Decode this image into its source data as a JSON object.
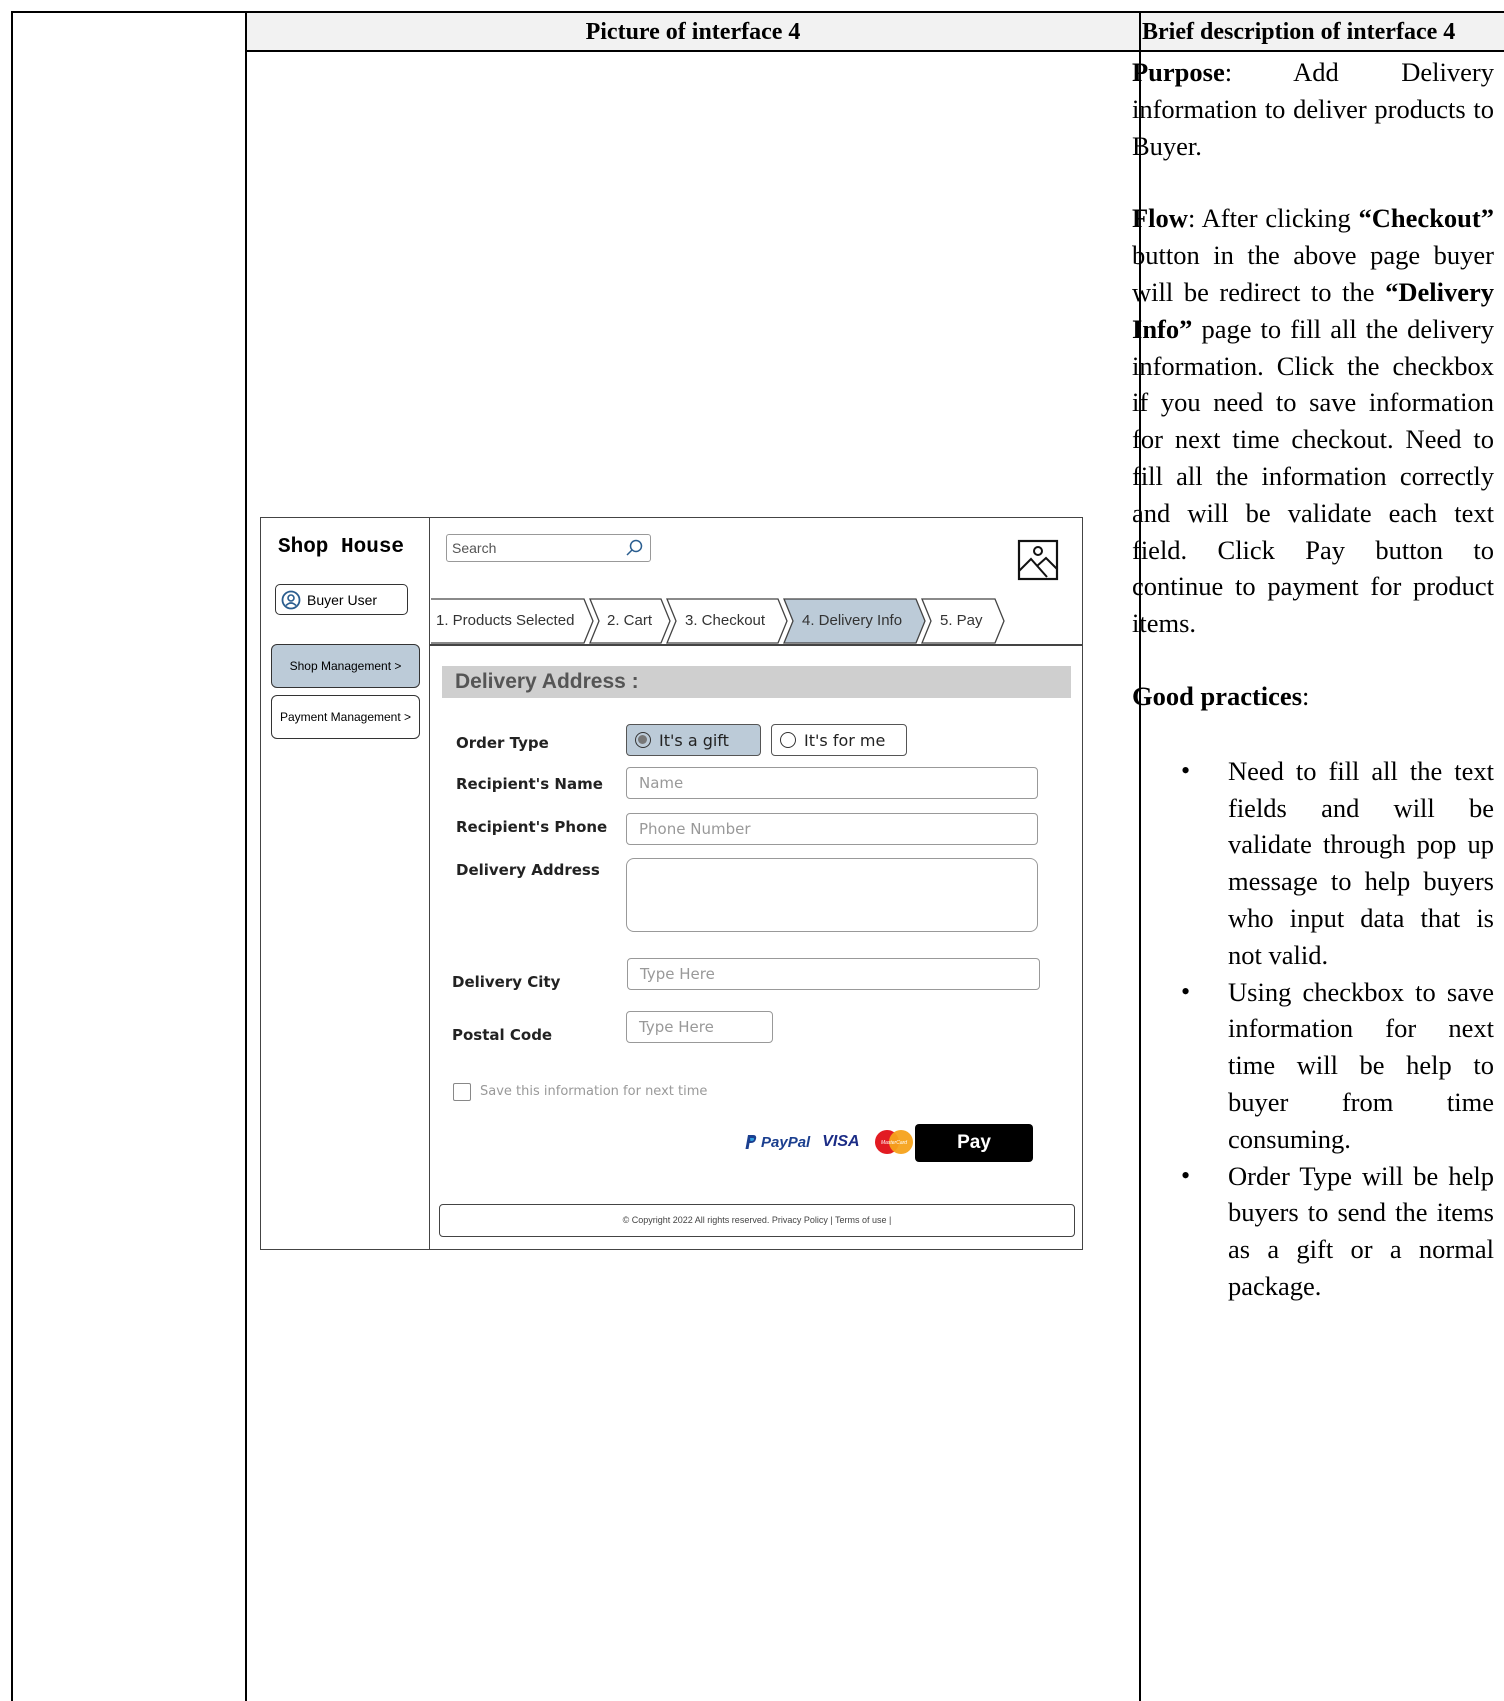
{
  "table": {
    "header_left": "Picture of interface 4",
    "header_right": "Brief description of interface 4"
  },
  "description": {
    "purpose_label": "Purpose",
    "purpose_text": ":   Add   Delivery information to deliver products to Buyer.",
    "flow_label": "Flow",
    "flow_text_1": ":   After   clicking ",
    "flow_bold_1": "“Checkout”",
    "flow_text_2": " button in the above page buyer will be redirect to the ",
    "flow_bold_2": "“Delivery Info”",
    "flow_text_3": " page to fill all the delivery information. Click the checkbox if you need to save information for next time checkout. Need to fill all the information correctly and will be validate each text field. Click Pay button to continue to payment for product items.",
    "good_practices_label": "Good practices",
    "good_practices_colon": ":",
    "bullets": [
      "Need to fill all the text fields and will be validate through pop up message to help buyers who input data that is not valid.",
      "Using checkbox to save information for next time will be help to buyer from time consuming.",
      "Order Type will be help buyers to send the items as a gift or a normal package."
    ]
  },
  "mockup": {
    "app_title": "Shop House",
    "user_label": "Buyer User",
    "sidebar": {
      "shop_management": "Shop Management >",
      "payment_management": "Payment Management >"
    },
    "search_placeholder": "Search",
    "steps": [
      "1. Products Selected",
      "2. Cart",
      "3. Checkout",
      "4. Delivery Info",
      "5. Pay"
    ],
    "active_step": 3,
    "section_title": "Delivery Address :",
    "fields": {
      "order_type_label": "Order Type",
      "gift_option": "It's a gift",
      "me_option": "It's for me",
      "name_label": "Recipient's Name",
      "name_placeholder": "Name",
      "phone_label": "Recipient's Phone",
      "phone_placeholder": "Phone Number",
      "address_label": "Delivery Address",
      "city_label": "Delivery City",
      "city_placeholder": "Type Here",
      "postal_label": "Postal Code",
      "postal_placeholder": "Type Here"
    },
    "save_checkbox_label": "Save this information for next time",
    "payment_logos": {
      "paypal": "PayPal",
      "visa": "VISA",
      "mastercard": "MasterCard"
    },
    "pay_button": "Pay",
    "footer": "© Copyright 2022 All rights reserved. Privacy Policy | Terms of use |",
    "colors": {
      "selected_fill": "#bccbd8",
      "section_bar": "#cfcfcf",
      "pay_button": "#000000"
    }
  }
}
